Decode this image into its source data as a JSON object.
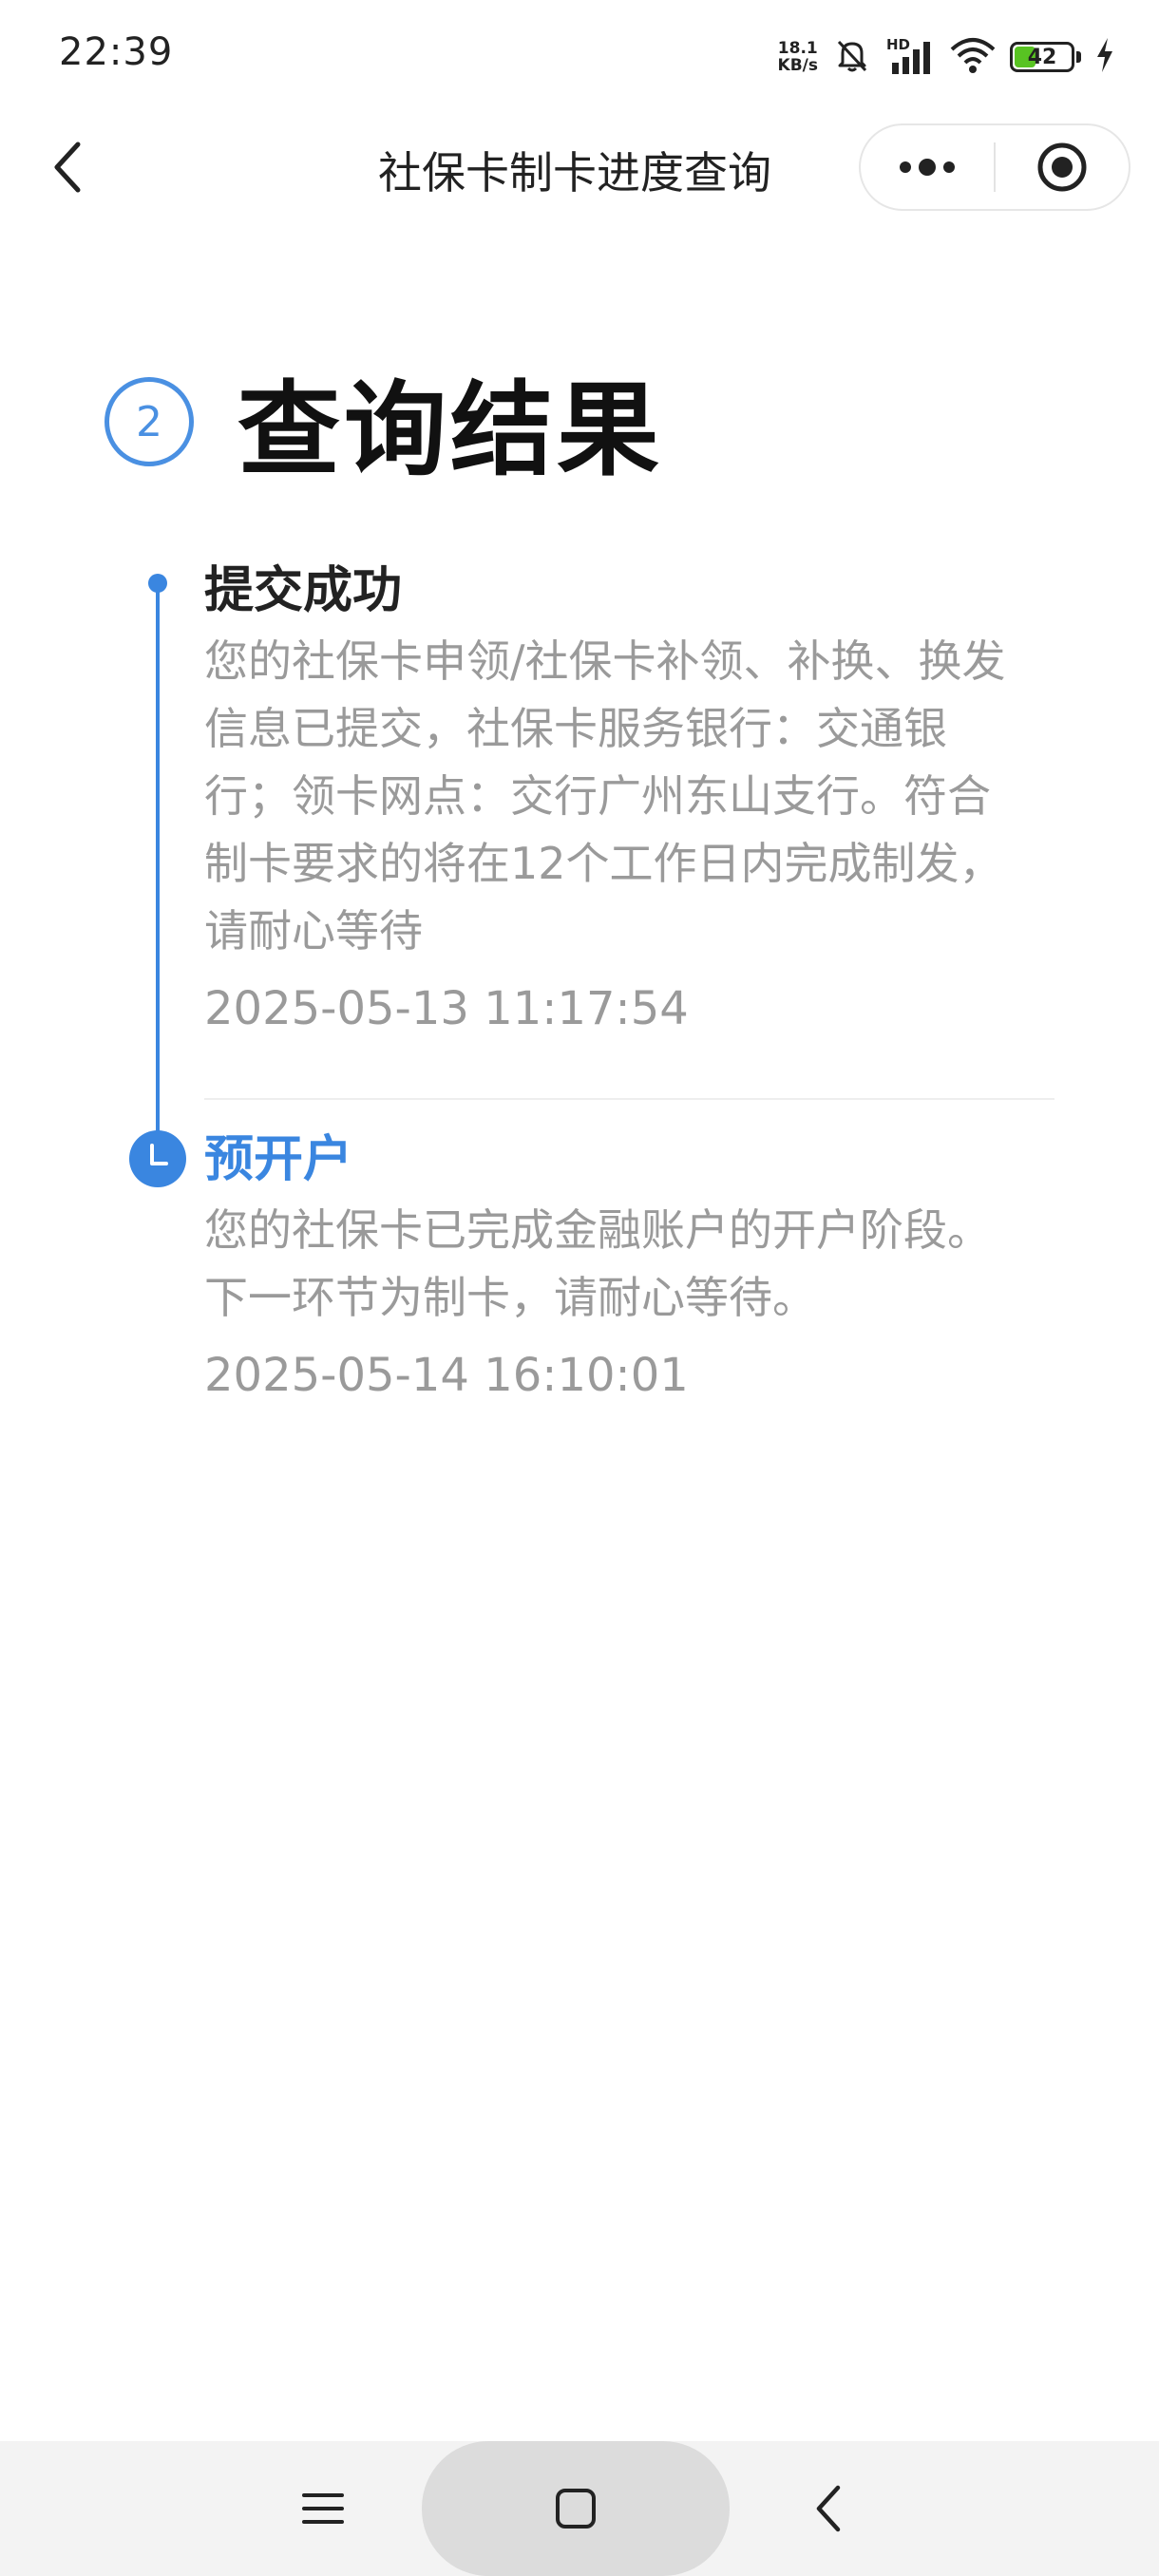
{
  "status_bar": {
    "time": "22:39",
    "net_speed_value": "18.1",
    "net_speed_unit": "KB/s",
    "signal_label": "HD",
    "battery_level": "42",
    "battery_percent": 42,
    "icons": [
      "mute-bell-icon",
      "signal-icon",
      "wifi-icon",
      "battery-icon",
      "charging-icon"
    ]
  },
  "nav": {
    "title": "社保卡制卡进度查询",
    "back_icon": "chevron-left-icon",
    "more_icon": "more-dots-icon",
    "close_icon": "target-circle-icon"
  },
  "result": {
    "step_number": "2",
    "title": "查询结果"
  },
  "timeline": [
    {
      "title": "提交成功",
      "description": "您的社保卡申领/社保卡补领、补换、换发信息已提交，社保卡服务银行：交通银行；领卡网点：交行广州东山支行。符合制卡要求的将在12个工作日内完成制发，请耐心等待",
      "time": "2025-05-13 11:17:54",
      "state": "done"
    },
    {
      "title": "预开户",
      "description": "您的社保卡已完成金融账户的开户阶段。下一环节为制卡，请耐心等待。",
      "time": "2025-05-14 16:10:01",
      "state": "current"
    }
  ],
  "colors": {
    "accent": "#3a86e0",
    "muted_text": "#9a9a9a",
    "battery_fill": "#58c322"
  },
  "system_nav": {
    "icons": [
      "menu-icon",
      "home-square-icon",
      "back-arrow-icon"
    ]
  }
}
